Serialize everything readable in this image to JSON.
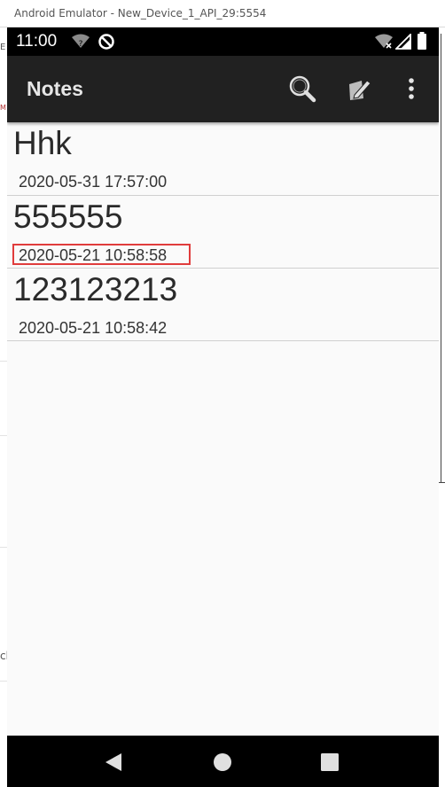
{
  "window": {
    "title": "Android Emulator - New_Device_1_API_29:5554"
  },
  "background": {
    "fragment_e": "E",
    "fragment_m": "M",
    "fragment_ch": "ch"
  },
  "status_bar": {
    "time": "11:00",
    "icons": [
      "wifi-question-icon",
      "do-not-disturb-icon",
      "wifi-icon",
      "signal-icon",
      "battery-icon"
    ]
  },
  "app_bar": {
    "title": "Notes",
    "actions": [
      "search-icon",
      "compose-icon",
      "more-vert-icon"
    ]
  },
  "notes": [
    {
      "title": "Hhk",
      "date": "2020-05-31 17:57:00"
    },
    {
      "title": "555555",
      "date": "2020-05-21 10:58:58"
    },
    {
      "title": "123123213",
      "date": "2020-05-21 10:58:42"
    }
  ],
  "nav_bar": {
    "buttons": [
      "back-icon",
      "home-icon",
      "recents-icon"
    ]
  },
  "colors": {
    "highlight": "#e03c3c",
    "app_bar": "#212121",
    "list_bg": "#fafafa"
  }
}
